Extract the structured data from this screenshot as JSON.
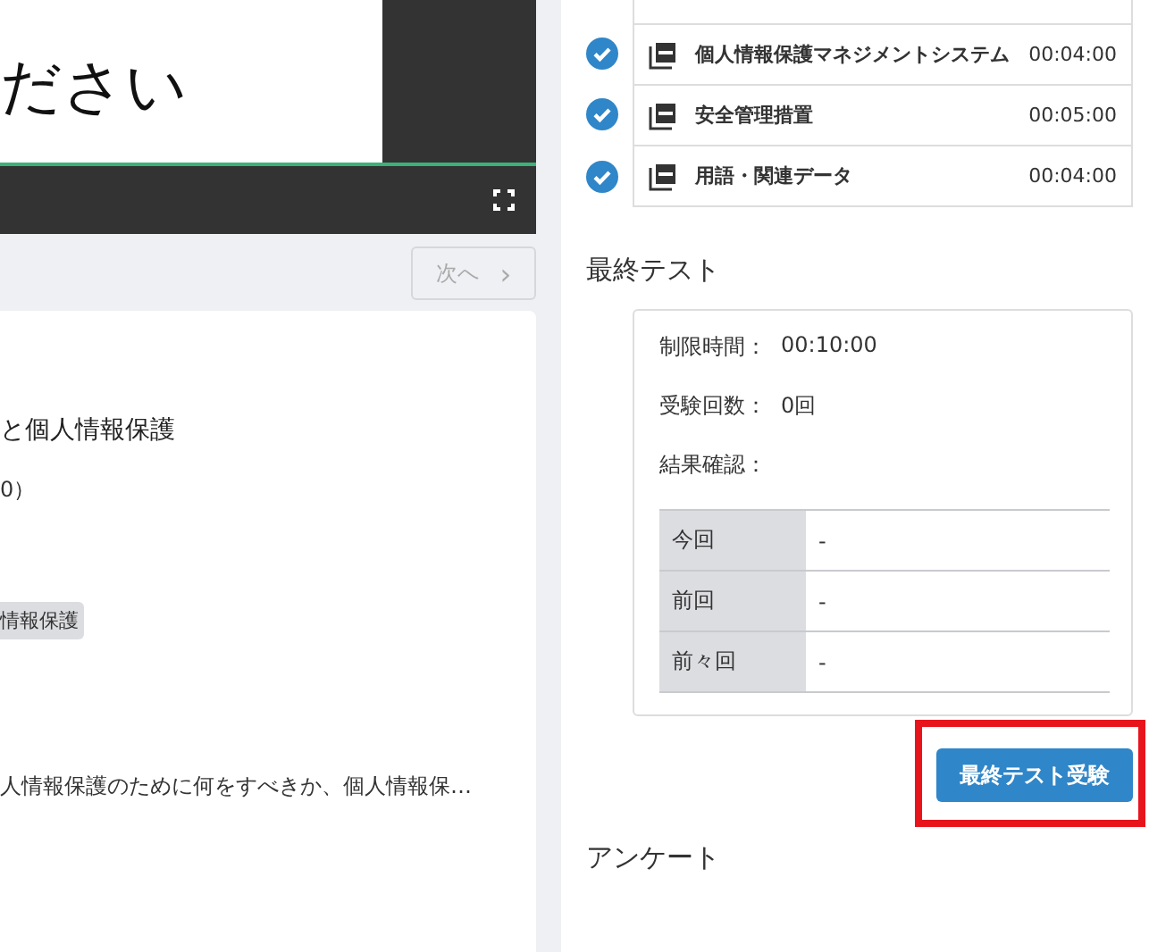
{
  "video": {
    "slide_text": "ださい",
    "level": 1.0
  },
  "next_button": {
    "label": "次へ",
    "icon": "›",
    "disabled": true
  },
  "course_card": {
    "title": "と個人情報保護",
    "meta": "0）",
    "tags": [
      "情報保護"
    ],
    "description": "人情報保護のために何をすべきか、個人情報保…"
  },
  "materials": [
    {
      "title": "個人情報保護マネジメントシステム",
      "duration": "00:04:00",
      "completed": true
    },
    {
      "title": "安全管理措置",
      "duration": "00:05:00",
      "completed": true
    },
    {
      "title": "用語・関連データ",
      "duration": "00:04:00",
      "completed": true
    }
  ],
  "final_test": {
    "heading": "最終テスト",
    "fields": [
      {
        "label": "制限時間：",
        "value": "00:10:00"
      },
      {
        "label": "受験回数：",
        "value": "0回"
      },
      {
        "label": "結果確認："
      }
    ],
    "results": [
      {
        "label": "今回",
        "value": "-"
      },
      {
        "label": "前回",
        "value": "-"
      },
      {
        "label": "前々回",
        "value": "-"
      }
    ],
    "button": {
      "label": "最終テスト受験",
      "highlighted": true
    }
  },
  "survey": {
    "heading": "アンケート"
  }
}
